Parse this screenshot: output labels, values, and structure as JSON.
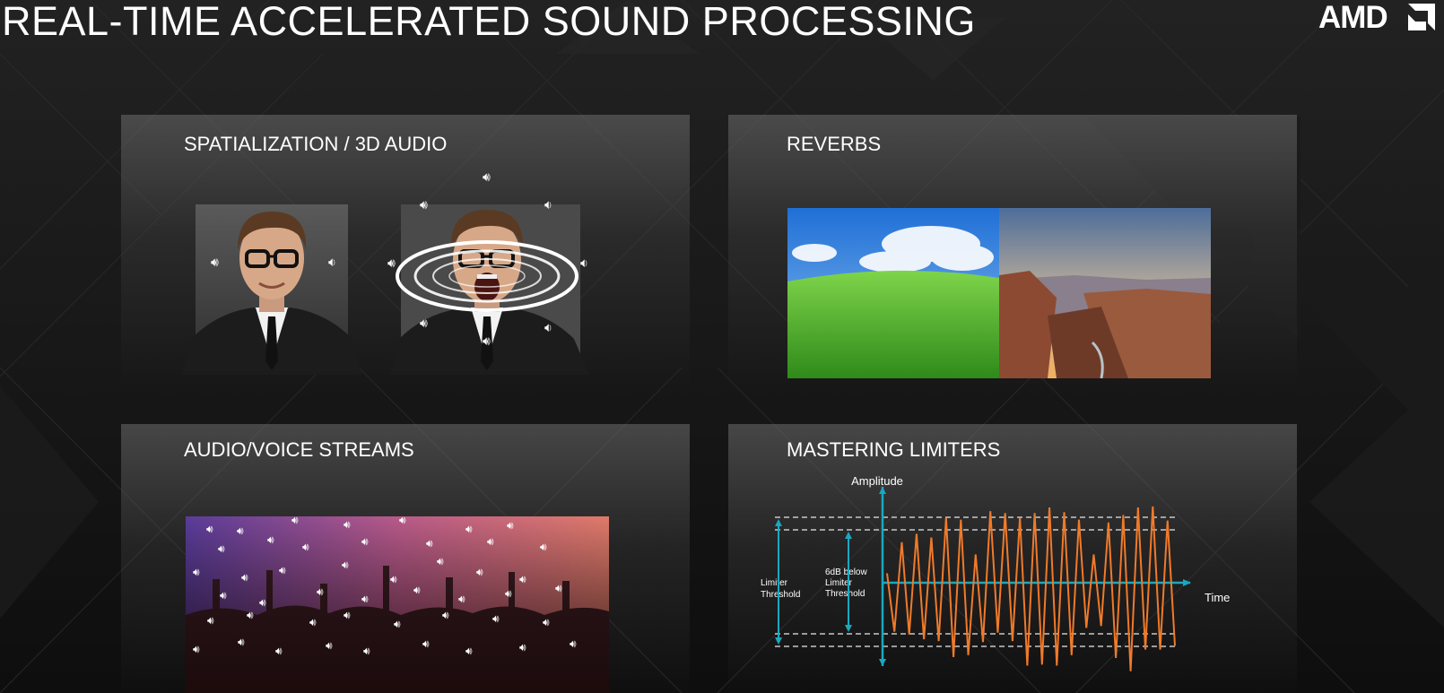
{
  "slide": {
    "title": "REAL-TIME ACCELERATED SOUND PROCESSING",
    "logo_text": "AMD"
  },
  "panels": {
    "spatialization": {
      "title": "SPATIALIZATION / 3D AUDIO",
      "icon": "speaker-icon"
    },
    "reverbs": {
      "title": "REVERBS"
    },
    "streams": {
      "title": "AUDIO/VOICE STREAMS",
      "icon": "speaker-icon"
    },
    "limiters": {
      "title": "MASTERING LIMITERS"
    }
  },
  "chart_data": {
    "type": "line",
    "ylabel": "Amplitude",
    "xlabel": "Time",
    "annotations": [
      "Limiter Threshold",
      "6dB below Limiter Threshold"
    ],
    "series": [
      {
        "name": "",
        "color": "#f07a2a",
        "y": [
          0.1,
          0.52,
          0.43,
          0.55,
          0.52,
          0.6,
          0.48,
          0.62,
          0.69,
          0.79,
          0.67,
          0.77,
          0.3,
          0.63,
          0.76,
          0.53,
          0.74,
          0.62,
          0.69,
          0.88,
          0.74,
          0.87,
          0.8,
          0.88,
          0.75,
          0.77,
          0.67,
          0.48,
          0.3,
          0.46,
          0.64,
          0.8,
          0.72,
          0.94,
          0.8,
          0.71,
          0.81,
          0.71,
          0.66,
          0.67
        ]
      }
    ],
    "colors": {
      "axes": "#1aa8c0",
      "threshold_lines": "#c8c8c8",
      "signal": "#f07a2a"
    }
  }
}
